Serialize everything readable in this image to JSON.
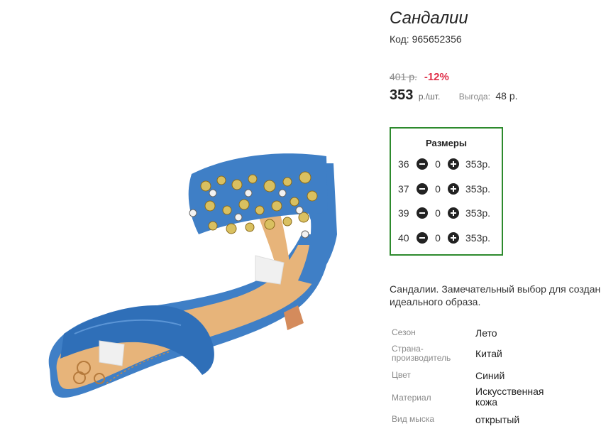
{
  "product": {
    "title": "Сандалии",
    "code": "Код: 965652356"
  },
  "pricing": {
    "old_price": "401 р.",
    "discount": "-12%",
    "price": "353",
    "price_unit": "р./шт.",
    "savings_label": "Выгода:",
    "savings_value": "48 р."
  },
  "sizes": {
    "title": "Размеры",
    "rows": [
      {
        "size": "36",
        "qty": "0",
        "price": "353р."
      },
      {
        "size": "37",
        "qty": "0",
        "price": "353р."
      },
      {
        "size": "39",
        "qty": "0",
        "price": "353р."
      },
      {
        "size": "40",
        "qty": "0",
        "price": "353р."
      }
    ]
  },
  "description": {
    "line1": "Сандалии. Замечательный выбор для создан",
    "line2": "идеального образа."
  },
  "specs": [
    {
      "label": "Сезон",
      "value": "Лето"
    },
    {
      "label": "Страна-\nпроизводитель",
      "value": "Китай"
    },
    {
      "label": "Цвет",
      "value": "Синий"
    },
    {
      "label": "Материал",
      "value": "Искусственная\nкожа"
    },
    {
      "label": "Вид мыска",
      "value": "открытый"
    }
  ],
  "colors": {
    "accent_green": "#2d8a2d",
    "discount_red": "#e0304a",
    "sandal_blue": "#3f7fc6"
  }
}
